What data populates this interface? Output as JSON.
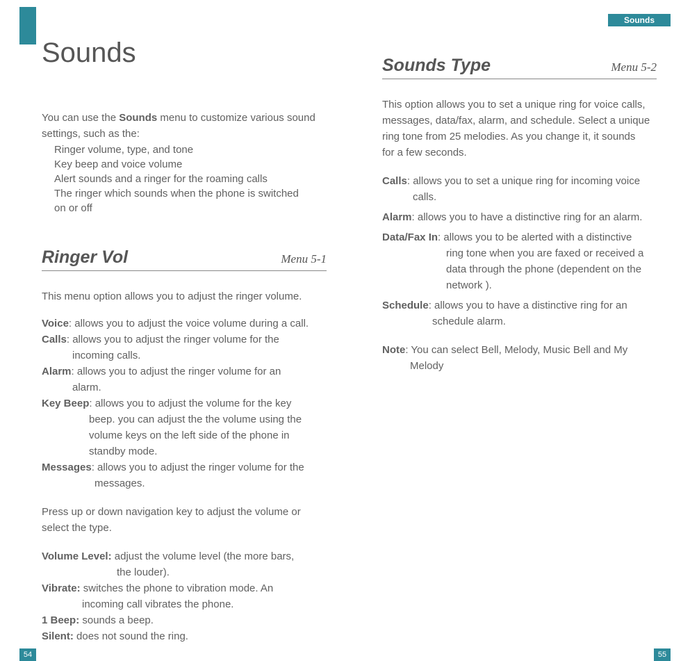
{
  "header": {
    "right_label": "Sounds"
  },
  "page_numbers": {
    "left": "54",
    "right": "55"
  },
  "left": {
    "chapter_title": "Sounds",
    "intro_line1_pre": "You can use the ",
    "intro_line1_b": "Sounds",
    "intro_line1_post": " menu to customize various sound",
    "intro_line2": "settings, such as the:",
    "b1": "Ringer volume, type, and tone",
    "b2": "Key beep and voice volume",
    "b3": "Alert sounds and a ringer for the roaming calls",
    "b4": "The ringer which sounds when the phone is switched",
    "b4b": "on or off",
    "sec_title": "Ringer Vol",
    "sec_menu": "Menu 5-1",
    "sec_intro": "This menu option allows you to adjust the ringer volume.",
    "voice_b": "Voice",
    "voice_t": ": allows you to adjust the voice volume during a call.",
    "calls_b": "Calls",
    "calls_t": ": allows you to adjust the ringer volume for the",
    "calls_t2": "incoming calls.",
    "alarm_b": "Alarm",
    "alarm_t": ": allows you to adjust the ringer volume for an",
    "alarm_t2": "alarm.",
    "key_b": "Key Beep",
    "key_t": ": allows you to adjust the volume for the key",
    "key_t2": "beep. you can adjust the the volume using the",
    "key_t3": "volume keys on the left side of the phone in",
    "key_t4": "standby mode.",
    "msg_b": "Messages",
    "msg_t": ": allows you to adjust the ringer volume for the",
    "msg_t2": "messages.",
    "nav_l1": "Press up or down navigation key to adjust the volume or",
    "nav_l2": "select the type.",
    "vol_b": "Volume Level:",
    "vol_t": " adjust the volume level (the more bars,",
    "vol_t2": "the louder).",
    "vib_b": "Vibrate:",
    "vib_t": " switches the phone to vibration mode. An",
    "vib_t2": "incoming call vibrates the phone.",
    "beep_b": "1 Beep:",
    "beep_t": " sounds a beep.",
    "sil_b": "Silent:",
    "sil_t": " does not sound the ring."
  },
  "right": {
    "sec_title": "Sounds Type",
    "sec_menu": "Menu 5-2",
    "p1": "This option allows you to set a unique ring for voice calls,",
    "p2": "messages, data/fax, alarm, and schedule. Select a unique",
    "p3": "ring tone from 25 melodies. As you change it, it sounds",
    "p4": "for a few seconds.",
    "calls_b": "Calls",
    "calls_t": ": allows you to set a unique ring for incoming voice",
    "calls_t2": "calls.",
    "alarm_b": "Alarm",
    "alarm_t": ": allows you to have a distinctive ring for an alarm.",
    "df_b": "Data/Fax In",
    "df_t": ": allows you to be alerted with a distinctive",
    "df_t2": "ring tone when you are faxed or received a",
    "df_t3": "data through the phone (dependent on the",
    "df_t4": "network ).",
    "sch_b": "Schedule",
    "sch_t": ": allows you to have a distinctive ring for an",
    "sch_t2": "schedule alarm.",
    "note_b": "Note",
    "note_t": ": You can select Bell, Melody, Music Bell and My",
    "note_t2": "Melody"
  }
}
